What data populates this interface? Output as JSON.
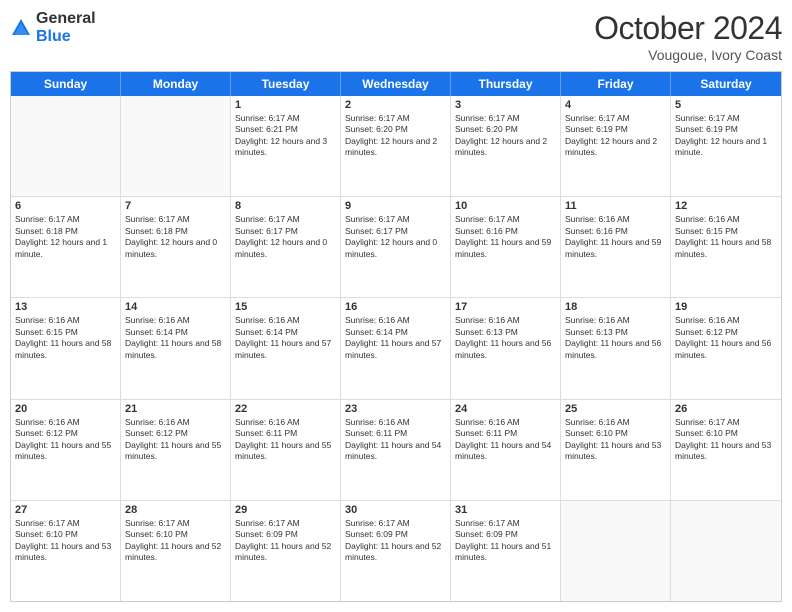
{
  "logo": {
    "general": "General",
    "blue": "Blue"
  },
  "header": {
    "month": "October 2024",
    "location": "Vougoue, Ivory Coast"
  },
  "weekdays": [
    "Sunday",
    "Monday",
    "Tuesday",
    "Wednesday",
    "Thursday",
    "Friday",
    "Saturday"
  ],
  "rows": [
    [
      {
        "day": "",
        "text": ""
      },
      {
        "day": "",
        "text": ""
      },
      {
        "day": "1",
        "text": "Sunrise: 6:17 AM\nSunset: 6:21 PM\nDaylight: 12 hours and 3 minutes."
      },
      {
        "day": "2",
        "text": "Sunrise: 6:17 AM\nSunset: 6:20 PM\nDaylight: 12 hours and 2 minutes."
      },
      {
        "day": "3",
        "text": "Sunrise: 6:17 AM\nSunset: 6:20 PM\nDaylight: 12 hours and 2 minutes."
      },
      {
        "day": "4",
        "text": "Sunrise: 6:17 AM\nSunset: 6:19 PM\nDaylight: 12 hours and 2 minutes."
      },
      {
        "day": "5",
        "text": "Sunrise: 6:17 AM\nSunset: 6:19 PM\nDaylight: 12 hours and 1 minute."
      }
    ],
    [
      {
        "day": "6",
        "text": "Sunrise: 6:17 AM\nSunset: 6:18 PM\nDaylight: 12 hours and 1 minute."
      },
      {
        "day": "7",
        "text": "Sunrise: 6:17 AM\nSunset: 6:18 PM\nDaylight: 12 hours and 0 minutes."
      },
      {
        "day": "8",
        "text": "Sunrise: 6:17 AM\nSunset: 6:17 PM\nDaylight: 12 hours and 0 minutes."
      },
      {
        "day": "9",
        "text": "Sunrise: 6:17 AM\nSunset: 6:17 PM\nDaylight: 12 hours and 0 minutes."
      },
      {
        "day": "10",
        "text": "Sunrise: 6:17 AM\nSunset: 6:16 PM\nDaylight: 11 hours and 59 minutes."
      },
      {
        "day": "11",
        "text": "Sunrise: 6:16 AM\nSunset: 6:16 PM\nDaylight: 11 hours and 59 minutes."
      },
      {
        "day": "12",
        "text": "Sunrise: 6:16 AM\nSunset: 6:15 PM\nDaylight: 11 hours and 58 minutes."
      }
    ],
    [
      {
        "day": "13",
        "text": "Sunrise: 6:16 AM\nSunset: 6:15 PM\nDaylight: 11 hours and 58 minutes."
      },
      {
        "day": "14",
        "text": "Sunrise: 6:16 AM\nSunset: 6:14 PM\nDaylight: 11 hours and 58 minutes."
      },
      {
        "day": "15",
        "text": "Sunrise: 6:16 AM\nSunset: 6:14 PM\nDaylight: 11 hours and 57 minutes."
      },
      {
        "day": "16",
        "text": "Sunrise: 6:16 AM\nSunset: 6:14 PM\nDaylight: 11 hours and 57 minutes."
      },
      {
        "day": "17",
        "text": "Sunrise: 6:16 AM\nSunset: 6:13 PM\nDaylight: 11 hours and 56 minutes."
      },
      {
        "day": "18",
        "text": "Sunrise: 6:16 AM\nSunset: 6:13 PM\nDaylight: 11 hours and 56 minutes."
      },
      {
        "day": "19",
        "text": "Sunrise: 6:16 AM\nSunset: 6:12 PM\nDaylight: 11 hours and 56 minutes."
      }
    ],
    [
      {
        "day": "20",
        "text": "Sunrise: 6:16 AM\nSunset: 6:12 PM\nDaylight: 11 hours and 55 minutes."
      },
      {
        "day": "21",
        "text": "Sunrise: 6:16 AM\nSunset: 6:12 PM\nDaylight: 11 hours and 55 minutes."
      },
      {
        "day": "22",
        "text": "Sunrise: 6:16 AM\nSunset: 6:11 PM\nDaylight: 11 hours and 55 minutes."
      },
      {
        "day": "23",
        "text": "Sunrise: 6:16 AM\nSunset: 6:11 PM\nDaylight: 11 hours and 54 minutes."
      },
      {
        "day": "24",
        "text": "Sunrise: 6:16 AM\nSunset: 6:11 PM\nDaylight: 11 hours and 54 minutes."
      },
      {
        "day": "25",
        "text": "Sunrise: 6:16 AM\nSunset: 6:10 PM\nDaylight: 11 hours and 53 minutes."
      },
      {
        "day": "26",
        "text": "Sunrise: 6:17 AM\nSunset: 6:10 PM\nDaylight: 11 hours and 53 minutes."
      }
    ],
    [
      {
        "day": "27",
        "text": "Sunrise: 6:17 AM\nSunset: 6:10 PM\nDaylight: 11 hours and 53 minutes."
      },
      {
        "day": "28",
        "text": "Sunrise: 6:17 AM\nSunset: 6:10 PM\nDaylight: 11 hours and 52 minutes."
      },
      {
        "day": "29",
        "text": "Sunrise: 6:17 AM\nSunset: 6:09 PM\nDaylight: 11 hours and 52 minutes."
      },
      {
        "day": "30",
        "text": "Sunrise: 6:17 AM\nSunset: 6:09 PM\nDaylight: 11 hours and 52 minutes."
      },
      {
        "day": "31",
        "text": "Sunrise: 6:17 AM\nSunset: 6:09 PM\nDaylight: 11 hours and 51 minutes."
      },
      {
        "day": "",
        "text": ""
      },
      {
        "day": "",
        "text": ""
      }
    ]
  ]
}
